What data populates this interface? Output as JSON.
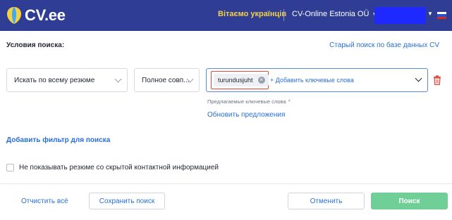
{
  "header": {
    "logo_text": "CV.ee",
    "greeting": "Вітаємо українців",
    "company": "CV-Online Estonia OÜ",
    "colors": {
      "bar": "#2f3e94",
      "greeting": "#f5d142",
      "user_box": "#1d29ff"
    },
    "icons": [
      "logo-icon",
      "chevron-down-icon",
      "russia-flag-icon"
    ]
  },
  "search": {
    "title": "Условия поиска:",
    "old_search_link": "Старый поиск по базе данных CV",
    "scope_select": "Искать по всему резюме",
    "match_select": "Полное совп...",
    "keyword_chip": "turundusjuht",
    "add_keywords": "+ Добавить ключевые слова",
    "suggested_label": "Предлагаемые ключевые слова",
    "refresh_suggestions": "Обновить предложения",
    "add_filter": "Добавить фильтр для поиска",
    "hide_hidden_contacts_label": "Не показывать резюме со скрытой контактной информацией",
    "hide_hidden_contacts_checked": false
  },
  "footer": {
    "clear_all": "Отчистить всё",
    "save_search": "Сохранить поиск",
    "cancel": "Отменить",
    "search": "Поиск",
    "colors": {
      "primary": "#6fcf97",
      "link": "#2a6fd6",
      "danger": "#e24a3b"
    }
  }
}
